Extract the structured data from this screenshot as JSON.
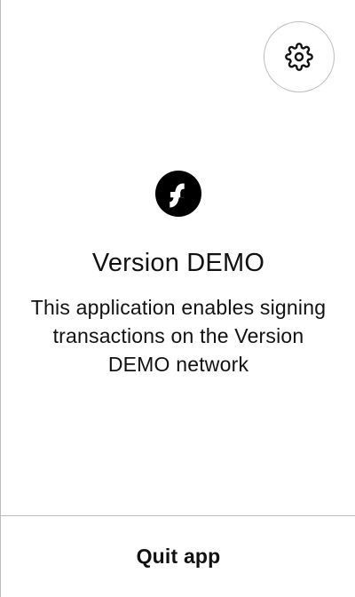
{
  "header": {
    "settings_icon": "gear-icon"
  },
  "main": {
    "logo_icon": "flow-logo",
    "title": "Version DEMO",
    "description": "This application enables signing transactions on the Version DEMO network"
  },
  "footer": {
    "quit_label": "Quit app"
  },
  "colors": {
    "background": "#ffffff",
    "text": "#111111",
    "border": "#bdbdbd",
    "logo_bg": "#000000"
  }
}
